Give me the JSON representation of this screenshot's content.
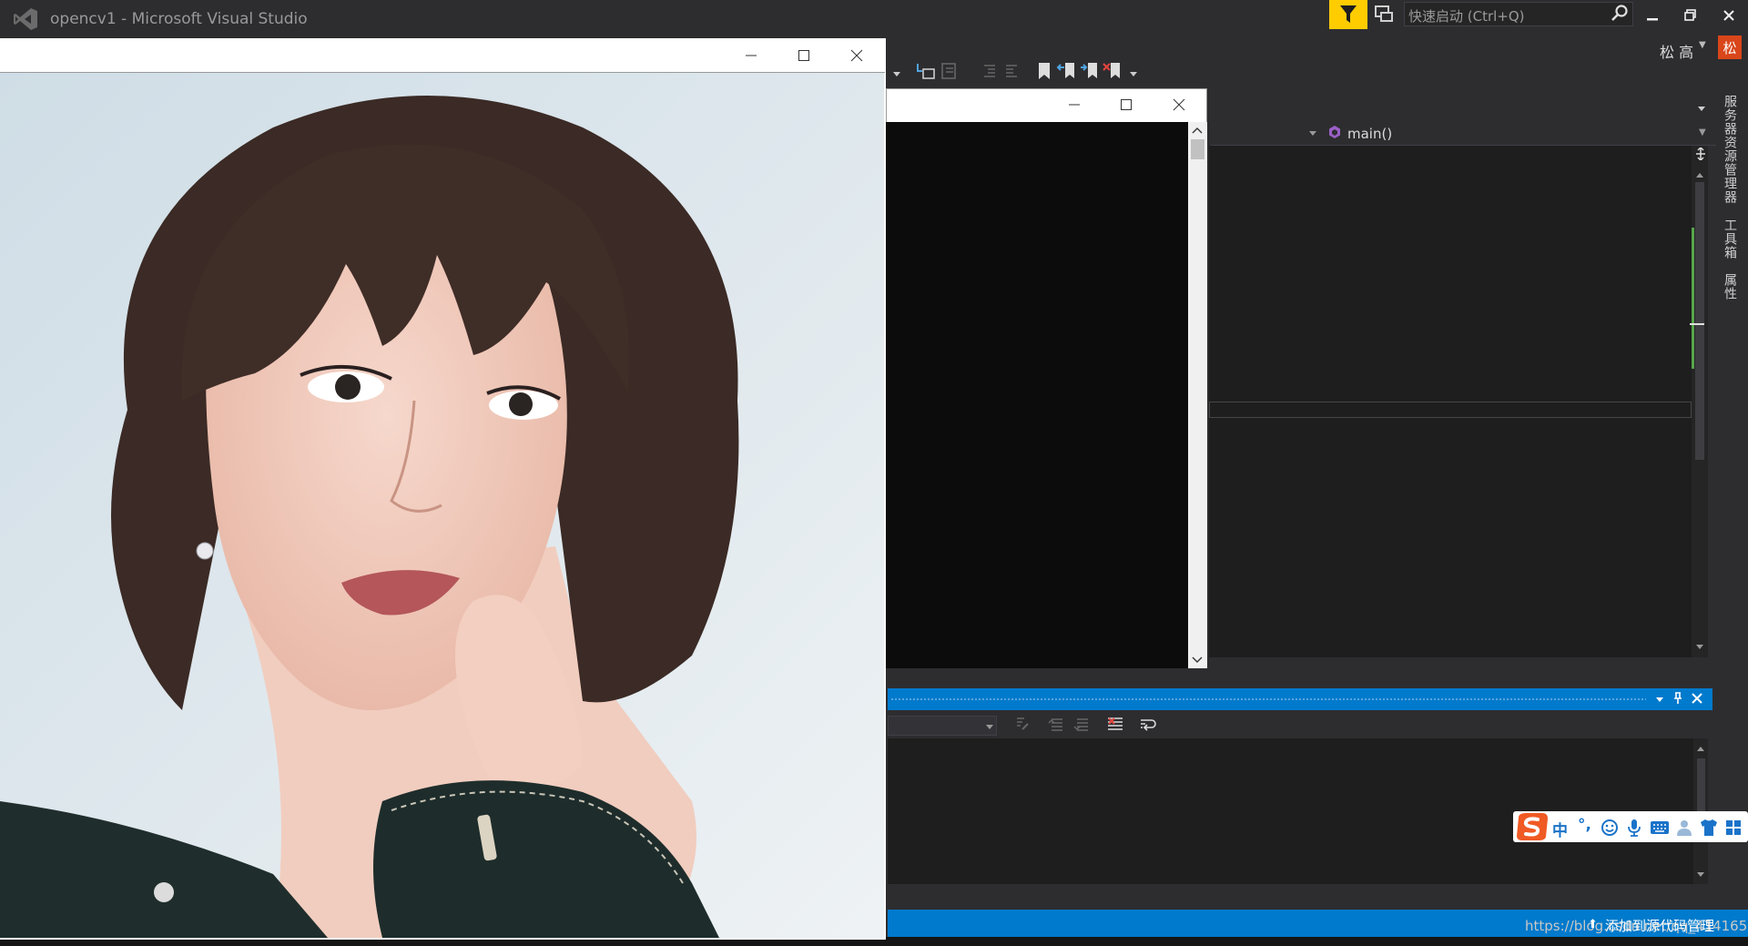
{
  "app": {
    "title": "opencv1 - Microsoft Visual Studio",
    "quick_launch_placeholder": "快速启动 (Ctrl+Q)",
    "user_name": "松 高",
    "user_initial": "松",
    "window_controls": [
      "minimize",
      "restore",
      "close"
    ]
  },
  "toolbar": {
    "icons": [
      "step-back-icon",
      "uncomment-icon",
      "indent-icon",
      "outdent-icon",
      "bookmark-icon",
      "prev-bookmark-icon",
      "next-bookmark-icon",
      "clear-bookmarks-icon",
      "overflow-icon"
    ]
  },
  "editor": {
    "member_dropdown": "main()"
  },
  "side_tabs": [
    "服务器资源管理器",
    "工具箱",
    "属性"
  ],
  "output_panel": {
    "toolbar_icons": [
      "find-icon",
      "prev-message-icon",
      "next-message-icon",
      "clear-all-icon",
      "word-wrap-icon"
    ]
  },
  "status_bar": {
    "source_control": "添加到源代码管理",
    "watermark": "https://blog.csdn.net/qq_41416566"
  },
  "ime": {
    "items": [
      "sogou-logo-icon",
      "中",
      "°,",
      "emoji-icon",
      "mic-icon",
      "keyboard-icon",
      "user-icon",
      "shirt-icon",
      "grid-icon"
    ]
  },
  "colors": {
    "vs_background": "#2d2d30",
    "accent_blue": "#007acc",
    "notification_yellow": "#ffcc00"
  }
}
